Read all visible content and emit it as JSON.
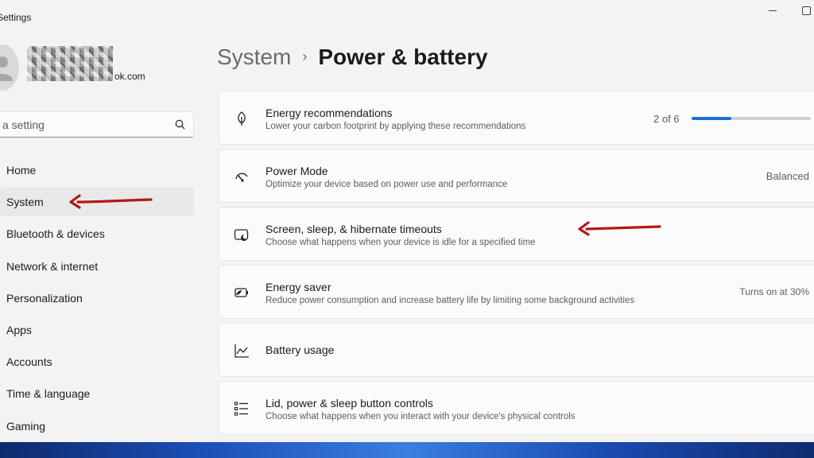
{
  "window": {
    "title": "Settings"
  },
  "profile": {
    "email_suffix": "ok.com"
  },
  "search": {
    "placeholder": "Find a setting",
    "visible_text": "a setting"
  },
  "nav": {
    "items": [
      {
        "label": "Home",
        "selected": false
      },
      {
        "label": "System",
        "selected": true
      },
      {
        "label": "Bluetooth & devices",
        "selected": false
      },
      {
        "label": "Network & internet",
        "selected": false
      },
      {
        "label": "Personalization",
        "selected": false
      },
      {
        "label": "Apps",
        "selected": false
      },
      {
        "label": "Accounts",
        "selected": false
      },
      {
        "label": "Time & language",
        "selected": false
      },
      {
        "label": "Gaming",
        "selected": false
      }
    ]
  },
  "breadcrumb": {
    "parent": "System",
    "separator": "›",
    "current": "Power & battery"
  },
  "cards": [
    {
      "title": "Energy recommendations",
      "subtitle": "Lower your carbon footprint by applying these recommendations",
      "value": "2 of 6",
      "progress": 0.33,
      "icon": "leaf-icon"
    },
    {
      "title": "Power Mode",
      "subtitle": "Optimize your device based on power use and performance",
      "value": "Balanced",
      "icon": "gauge-icon"
    },
    {
      "title": "Screen, sleep, & hibernate timeouts",
      "subtitle": "Choose what happens when your device is idle for a specified time",
      "value": "",
      "icon": "screen-sleep-icon"
    },
    {
      "title": "Energy saver",
      "subtitle": "Reduce power consumption and increase battery life by limiting some background activities",
      "value": "Turns on at 30%",
      "icon": "energy-saver-icon"
    },
    {
      "title": "Battery usage",
      "subtitle": "",
      "value": "",
      "icon": "chart-icon"
    },
    {
      "title": "Lid, power & sleep button controls",
      "subtitle": "Choose what happens when you interact with your device's physical controls",
      "value": "",
      "icon": "list-icon"
    }
  ],
  "colors": {
    "accent": "#1f6fd1",
    "annotation": "#b01818",
    "window_bg": "#f3f3f3",
    "card_bg": "#fbfbfb"
  }
}
